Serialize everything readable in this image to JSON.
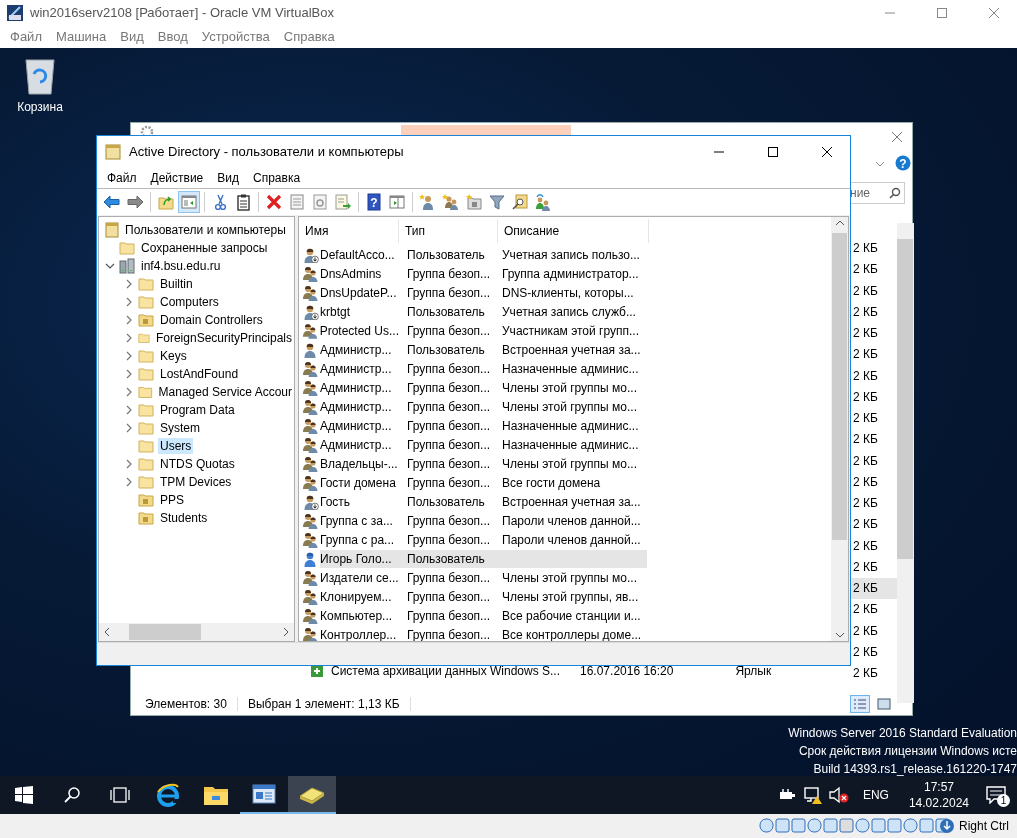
{
  "vbox": {
    "title": "win2016serv2108 [Работает] - Oracle VM VirtualBox",
    "menu": [
      "Файл",
      "Машина",
      "Вид",
      "Ввод",
      "Устройства",
      "Справка"
    ],
    "host_key": "Right Ctrl"
  },
  "desktop": {
    "icons": [
      {
        "label": "Корзина",
        "kind": "recycle-bin"
      }
    ],
    "watermark": [
      "Windows Server 2016 Standard Evaluation",
      "Срок действия лицензии Windows исте",
      "Build 14393.rs1_release.161220-1747"
    ]
  },
  "explorer": {
    "help_glyph": "?",
    "search_placeholder": "ние",
    "sizes": [
      {
        "text": "2 КБ",
        "selected": false
      },
      {
        "text": "2 КБ",
        "selected": false
      },
      {
        "text": "2 КБ",
        "selected": false
      },
      {
        "text": "2 КБ",
        "selected": false
      },
      {
        "text": "2 КБ",
        "selected": false
      },
      {
        "text": "2 КБ",
        "selected": false
      },
      {
        "text": "2 КБ",
        "selected": false
      },
      {
        "text": "2 КБ",
        "selected": false
      },
      {
        "text": "2 КБ",
        "selected": false
      },
      {
        "text": "2 КБ",
        "selected": false
      },
      {
        "text": "2 КБ",
        "selected": false
      },
      {
        "text": "2 КБ",
        "selected": false
      },
      {
        "text": "2 КБ",
        "selected": false
      },
      {
        "text": "2 КБ",
        "selected": false
      },
      {
        "text": "2 КБ",
        "selected": false
      },
      {
        "text": "2 КБ",
        "selected": false
      },
      {
        "text": "2 КБ",
        "selected": true
      },
      {
        "text": "2 КБ",
        "selected": false
      },
      {
        "text": "2 КБ",
        "selected": false
      },
      {
        "text": "2 КБ",
        "selected": false
      },
      {
        "text": "2 КБ",
        "selected": false
      }
    ],
    "file_row": {
      "name": "Система архивации данных Windows S...",
      "date": "16.07.2016 16:20",
      "type": "Ярлык"
    },
    "status": [
      "Элементов: 30",
      "Выбран 1 элемент: 1,13 КБ"
    ]
  },
  "aduc": {
    "title": "Active Directory - пользователи и компьютеры",
    "menu": [
      "Файл",
      "Действие",
      "Вид",
      "Справка"
    ],
    "toolbar": [
      {
        "kind": "back",
        "pressed": false
      },
      {
        "kind": "forward",
        "pressed": false
      },
      {
        "kind": "sep"
      },
      {
        "kind": "up",
        "pressed": false
      },
      {
        "kind": "tree",
        "pressed": true
      },
      {
        "kind": "sep"
      },
      {
        "kind": "cut",
        "pressed": false
      },
      {
        "kind": "paste",
        "pressed": false
      },
      {
        "kind": "sep"
      },
      {
        "kind": "delete",
        "pressed": false
      },
      {
        "kind": "properties",
        "pressed": false
      },
      {
        "kind": "refresh",
        "pressed": false
      },
      {
        "kind": "export",
        "pressed": false
      },
      {
        "kind": "sep"
      },
      {
        "kind": "help",
        "pressed": false,
        "glyph": "?"
      },
      {
        "kind": "pane",
        "pressed": false
      },
      {
        "kind": "sep"
      },
      {
        "kind": "new-user",
        "pressed": false
      },
      {
        "kind": "new-group",
        "pressed": false
      },
      {
        "kind": "new-ou",
        "pressed": false
      },
      {
        "kind": "filter",
        "pressed": false
      },
      {
        "kind": "find",
        "pressed": false
      },
      {
        "kind": "delegate",
        "pressed": false
      }
    ],
    "tree": {
      "root": "Пользователи и компьютеры",
      "items": [
        {
          "label": "Сохраненные запросы",
          "kind": "folder",
          "expandable": false,
          "expanded": false,
          "selected": false
        },
        {
          "label": "inf4.bsu.edu.ru",
          "kind": "domain",
          "expandable": true,
          "expanded": true,
          "selected": false,
          "children": [
            {
              "label": "Builtin",
              "kind": "container",
              "expandable": true,
              "expanded": false,
              "selected": false
            },
            {
              "label": "Computers",
              "kind": "container",
              "expandable": true,
              "expanded": false,
              "selected": false
            },
            {
              "label": "Domain Controllers",
              "kind": "ou",
              "expandable": true,
              "expanded": false,
              "selected": false
            },
            {
              "label": "ForeignSecurityPrincipals",
              "kind": "container",
              "expandable": true,
              "expanded": false,
              "selected": false
            },
            {
              "label": "Keys",
              "kind": "container",
              "expandable": true,
              "expanded": false,
              "selected": false
            },
            {
              "label": "LostAndFound",
              "kind": "container",
              "expandable": true,
              "expanded": false,
              "selected": false
            },
            {
              "label": "Managed Service Accour",
              "kind": "container",
              "expandable": true,
              "expanded": false,
              "selected": false
            },
            {
              "label": "Program Data",
              "kind": "container",
              "expandable": true,
              "expanded": false,
              "selected": false
            },
            {
              "label": "System",
              "kind": "container",
              "expandable": true,
              "expanded": false,
              "selected": false
            },
            {
              "label": "Users",
              "kind": "container",
              "expandable": false,
              "expanded": false,
              "selected": true
            },
            {
              "label": "NTDS Quotas",
              "kind": "container",
              "expandable": true,
              "expanded": false,
              "selected": false
            },
            {
              "label": "TPM Devices",
              "kind": "container",
              "expandable": true,
              "expanded": false,
              "selected": false
            },
            {
              "label": "PPS",
              "kind": "ou",
              "expandable": false,
              "expanded": false,
              "selected": false
            },
            {
              "label": "Students",
              "kind": "ou",
              "expandable": false,
              "expanded": false,
              "selected": false
            }
          ]
        }
      ]
    },
    "columns": [
      "Имя",
      "Тип",
      "Описание"
    ],
    "rows": [
      {
        "name": "DefaultAcco...",
        "type": "Пользователь",
        "description": "Учетная запись пользо...",
        "kind": "user",
        "disabled": true,
        "selected": false
      },
      {
        "name": "DnsAdmins",
        "type": "Группа безоп...",
        "description": "Группа администратор...",
        "kind": "group",
        "disabled": false,
        "selected": false
      },
      {
        "name": "DnsUpdateP...",
        "type": "Группа безоп...",
        "description": "DNS-клиенты, которы...",
        "kind": "group",
        "disabled": false,
        "selected": false
      },
      {
        "name": "krbtgt",
        "type": "Пользователь",
        "description": "Учетная запись служб...",
        "kind": "user",
        "disabled": true,
        "selected": false
      },
      {
        "name": "Protected Us...",
        "type": "Группа безоп...",
        "description": "Участникам этой групп...",
        "kind": "group",
        "disabled": false,
        "selected": false
      },
      {
        "name": "Администр...",
        "type": "Пользователь",
        "description": "Встроенная учетная за...",
        "kind": "user",
        "disabled": false,
        "selected": false
      },
      {
        "name": "Администр...",
        "type": "Группа безоп...",
        "description": "Назначенные админис...",
        "kind": "group",
        "disabled": false,
        "selected": false
      },
      {
        "name": "Администр...",
        "type": "Группа безоп...",
        "description": "Члены этой группы мо...",
        "kind": "group",
        "disabled": false,
        "selected": false
      },
      {
        "name": "Администр...",
        "type": "Группа безоп...",
        "description": "Члены этой группы мо...",
        "kind": "group",
        "disabled": false,
        "selected": false
      },
      {
        "name": "Администр...",
        "type": "Группа безоп...",
        "description": "Назначенные админис...",
        "kind": "group",
        "disabled": false,
        "selected": false
      },
      {
        "name": "Администр...",
        "type": "Группа безоп...",
        "description": "Назначенные админис...",
        "kind": "group",
        "disabled": false,
        "selected": false
      },
      {
        "name": "Владельцы-...",
        "type": "Группа безоп...",
        "description": "Члены этой группы мо...",
        "kind": "group",
        "disabled": false,
        "selected": false
      },
      {
        "name": "Гости домена",
        "type": "Группа безоп...",
        "description": "Все гости домена",
        "kind": "group",
        "disabled": false,
        "selected": false
      },
      {
        "name": "Гость",
        "type": "Пользователь",
        "description": "Встроенная учетная за...",
        "kind": "user",
        "disabled": true,
        "selected": false
      },
      {
        "name": "Группа с за...",
        "type": "Группа безоп...",
        "description": "Пароли членов данной...",
        "kind": "group",
        "disabled": false,
        "selected": false
      },
      {
        "name": "Группа с ра...",
        "type": "Группа безоп...",
        "description": "Пароли членов данной...",
        "kind": "group",
        "disabled": false,
        "selected": false
      },
      {
        "name": "Игорь Голо...",
        "type": "Пользователь",
        "kind": "user",
        "disabled": false,
        "selected": true
      },
      {
        "name": "Издатели се...",
        "type": "Группа безоп...",
        "description": "Члены этой группы мо...",
        "kind": "group",
        "disabled": false,
        "selected": false
      },
      {
        "name": "Клонируем...",
        "type": "Группа безоп...",
        "description": "Члены этой группы, яв...",
        "kind": "group",
        "disabled": false,
        "selected": false
      },
      {
        "name": "Компьютер...",
        "type": "Группа безоп...",
        "description": "Все рабочие станции и...",
        "kind": "group",
        "disabled": false,
        "selected": false
      },
      {
        "name": "Контроллер...",
        "type": "Группа безоп...",
        "description": "Все контроллеры доме...",
        "kind": "group",
        "disabled": false,
        "selected": false
      }
    ]
  },
  "taskbar": {
    "apps": [
      {
        "kind": "ie",
        "running": false,
        "selected": false
      },
      {
        "kind": "explorer",
        "running": false,
        "selected": false
      },
      {
        "kind": "aduc",
        "running": true,
        "selected": false
      },
      {
        "kind": "server-manager",
        "running": true,
        "selected": true
      }
    ],
    "lang": "ENG",
    "time": "17:57",
    "date": "14.02.2024",
    "notifications": "1"
  }
}
